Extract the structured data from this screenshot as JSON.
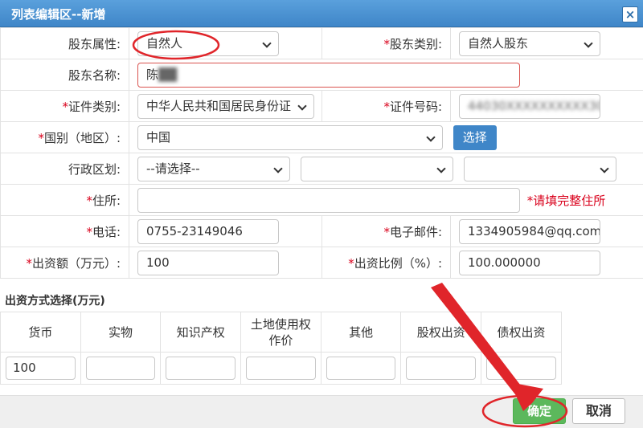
{
  "window": {
    "title": "列表编辑区--新增",
    "close": "×"
  },
  "form": {
    "shareholder_attr": {
      "label": "股东属性:",
      "value": "自然人"
    },
    "shareholder_type": {
      "label": "股东类别:",
      "value": "自然人股东"
    },
    "shareholder_name": {
      "label": "股东名称:",
      "value": "陈",
      "redacted": "██"
    },
    "cert_type": {
      "label": "证件类别:",
      "value": "中华人民共和国居民身份证"
    },
    "cert_no": {
      "label": "证件号码:",
      "value": "44030XXXXXXXXXX30"
    },
    "country": {
      "label": "国别（地区）:",
      "value": "中国",
      "choose": "选择"
    },
    "admin_region": {
      "label": "行政区划:",
      "value1": "--请选择--",
      "value2": "",
      "value3": ""
    },
    "address": {
      "label": "住所:",
      "value": "",
      "hint": "*请填完整住所"
    },
    "phone": {
      "label": "电话:",
      "value": "0755-23149046"
    },
    "email": {
      "label": "电子邮件:",
      "value": "1334905984@qq.com"
    },
    "capital": {
      "label": "出资额（万元）:",
      "value": "100"
    },
    "ratio": {
      "label": "出资比例（%）:",
      "value": "100.000000"
    }
  },
  "contribution": {
    "title": "出资方式选择(万元)",
    "columns": [
      "货币",
      "实物",
      "知识产权",
      "土地使用权作价",
      "其他",
      "股权出资",
      "债权出资"
    ],
    "values": [
      "100",
      "",
      "",
      "",
      "",
      "",
      ""
    ]
  },
  "footer": {
    "ok": "确定",
    "cancel": "取消"
  },
  "colors": {
    "title_bg": "#3f86c8",
    "required": "#d9001b",
    "ok_bg": "#5cb85c",
    "annotation": "#e0252a"
  }
}
